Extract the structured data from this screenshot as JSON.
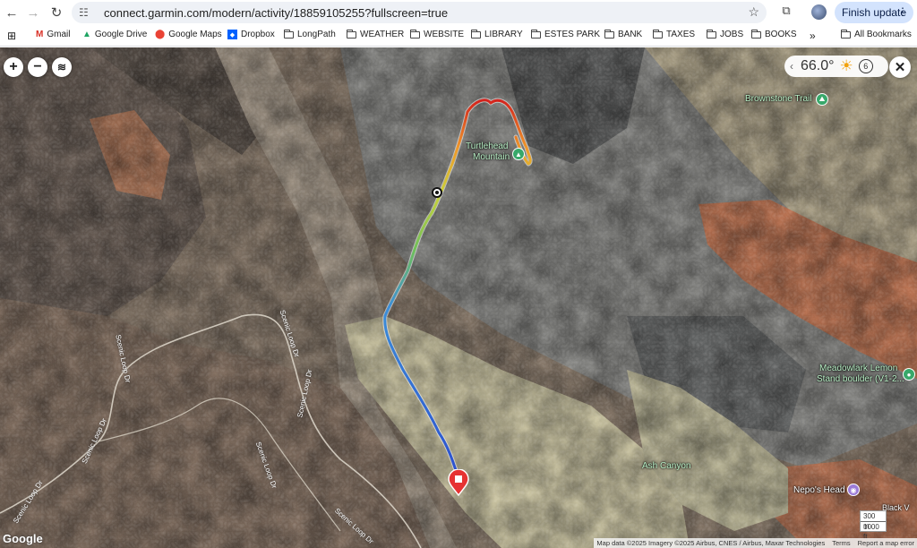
{
  "browser": {
    "url": "connect.garmin.com/modern/activity/18859105255?fullscreen=true",
    "finish_update": "Finish update",
    "bookmarks": [
      "Gmail",
      "Google Drive",
      "Google Maps",
      "Dropbox",
      "LongPath",
      "WEATHER",
      "WEBSITE",
      "LIBRARY",
      "ESTES PARK",
      "BANK",
      "TAXES",
      "JOBS",
      "BOOKS"
    ],
    "overflow": "»",
    "all_bookmarks": "All Bookmarks"
  },
  "map": {
    "zoom_in": "+",
    "zoom_out": "−",
    "weather": {
      "temperature": "66.0°",
      "wind": "6"
    },
    "labels": {
      "brownstone_trail": "Brownstone Trail",
      "turtlehead_line1": "Turtlehead",
      "turtlehead_line2": "Mountain",
      "meadowlark_line1": "Meadowlark Lemon",
      "meadowlark_line2": "Stand boulder (V1-2...",
      "ash_canyon": "Ash Canyon",
      "nepos_head": "Nepo's Head",
      "blackv": "Black V",
      "scenic_loop": "Scenic Loop Dr"
    },
    "scale": {
      "metric": "300 m",
      "imperial": "1000 ft"
    },
    "google": "Google",
    "attribution": {
      "data": "Map data ©2025 Imagery ©2025 Airbus, CNES / Airbus, Maxar Technologies",
      "terms": "Terms",
      "report": "Report a map error"
    }
  },
  "colors": {
    "start_marker": "#e63232",
    "track_low": "#2e5fd6",
    "track_high": "#d81d1d"
  }
}
